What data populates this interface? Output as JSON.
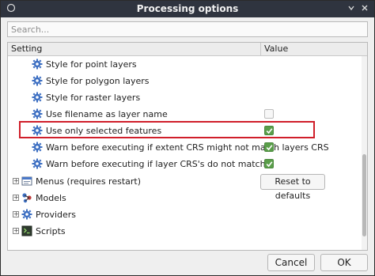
{
  "window": {
    "title": "Processing options"
  },
  "search": {
    "placeholder": "Search..."
  },
  "table": {
    "col_setting": "Setting",
    "col_value": "Value"
  },
  "rows": [
    {
      "label": "Style for point layers"
    },
    {
      "label": "Style for polygon layers"
    },
    {
      "label": "Style for raster layers"
    },
    {
      "label": "Use filename as layer name",
      "checked": false
    },
    {
      "label": "Use only selected features",
      "checked": true
    },
    {
      "label": "Warn before executing if extent CRS might not match layers CRS",
      "checked": true
    },
    {
      "label": "Warn before executing if layer CRS's do not match",
      "checked": true
    }
  ],
  "groups": [
    {
      "label": "Menus (requires restart)",
      "icon": "menu-icon"
    },
    {
      "label": "Models",
      "icon": "models-icon"
    },
    {
      "label": "Providers",
      "icon": "gear-icon"
    },
    {
      "label": "Scripts",
      "icon": "script-icon"
    }
  ],
  "buttons": {
    "reset": "Reset to defaults",
    "cancel": "Cancel",
    "ok": "OK"
  },
  "colors": {
    "titlebar": "#2f343f",
    "highlight": "#d01f2a",
    "checkbox_on": "#5a9e4a"
  }
}
